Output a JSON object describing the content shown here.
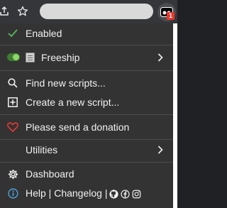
{
  "toolbar": {
    "share_icon": "share-icon",
    "star_icon": "star-icon",
    "extension_badge": "1"
  },
  "menu": {
    "enabled_label": "Enabled",
    "script_name": "Freeship",
    "find_scripts_label": "Find new scripts...",
    "create_script_label": "Create a new script...",
    "donation_label": "Please send a donation",
    "utilities_label": "Utilities",
    "dashboard_label": "Dashboard",
    "help_label": "Help | Changelog |"
  },
  "colors": {
    "menu_bg": "#333333",
    "text": "#f1f1f1",
    "check": "#5cb85c",
    "heart": "#e53935",
    "help_icon": "#4aa3df",
    "badge": "#e8342a"
  }
}
